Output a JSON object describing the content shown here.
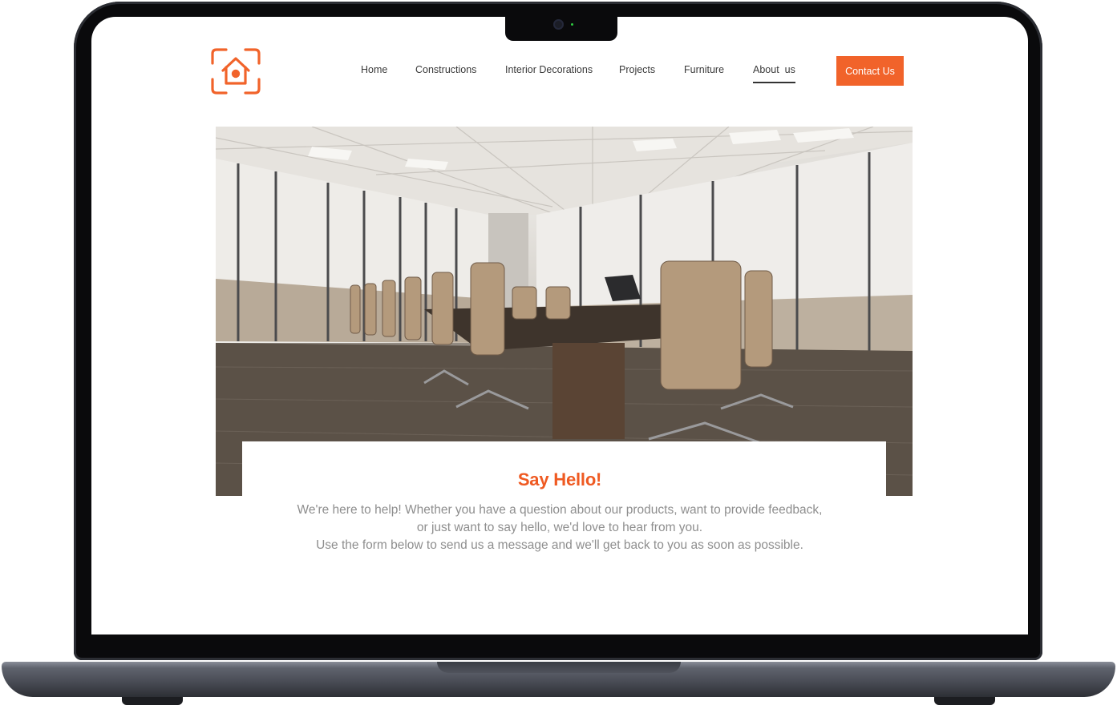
{
  "site": {
    "logo_icon": "home-frame-logo-icon",
    "brand_color": "#f1632a",
    "nav": {
      "items": [
        {
          "label": "Home",
          "active": false
        },
        {
          "label": "Constructions",
          "active": false
        },
        {
          "label": "Interior Decorations",
          "active": false
        },
        {
          "label": "Projects",
          "active": false
        },
        {
          "label": "Furniture",
          "active": false
        },
        {
          "label": "About  us",
          "active": true
        }
      ],
      "cta_label": "Contact Us"
    },
    "hero": {
      "image": "conference-room-photo"
    },
    "content": {
      "title": "Say Hello!",
      "intro_lines": [
        "We're here to help! Whether you have a question about our products, want to provide feedback,",
        "or just want to say hello, we'd love to hear from you.",
        "Use the form below to send us a message and we'll get back to you as soon as possible."
      ]
    }
  }
}
